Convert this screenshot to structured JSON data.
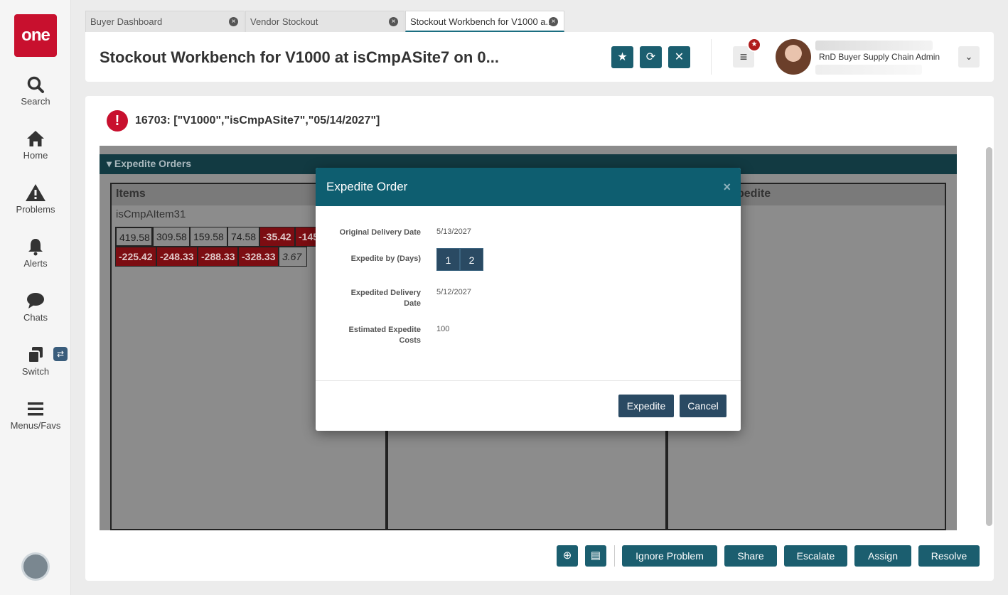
{
  "sidebar": {
    "logo": "one",
    "items": [
      {
        "label": "Search",
        "icon": "search-icon"
      },
      {
        "label": "Home",
        "icon": "home-icon"
      },
      {
        "label": "Problems",
        "icon": "warning-icon"
      },
      {
        "label": "Alerts",
        "icon": "bell-icon"
      },
      {
        "label": "Chats",
        "icon": "chat-icon"
      },
      {
        "label": "Switch",
        "icon": "switch-icon"
      },
      {
        "label": "Menus/Favs",
        "icon": "menu-icon"
      }
    ],
    "switch_badge": "⇄"
  },
  "tabs": [
    {
      "label": "Buyer Dashboard"
    },
    {
      "label": "Vendor Stockout"
    },
    {
      "label": "Stockout Workbench for V1000 a..."
    }
  ],
  "header": {
    "title": "Stockout Workbench for V1000 at isCmpASite7 on 0...",
    "user_role": "RnD Buyer Supply Chain Admin"
  },
  "main": {
    "error_text": "16703: [\"V1000\",\"isCmpASite7\",\"05/14/2027\"]",
    "panel_title": "Expedite Orders",
    "columns": [
      {
        "header": "Items"
      },
      {
        "header": ""
      },
      {
        "header": "pedite"
      }
    ],
    "item_name": "isCmpAItem31",
    "row1": [
      "419.58",
      "309.58",
      "159.58",
      "74.58",
      "-35.42",
      "-145"
    ],
    "row2": [
      "-225.42",
      "-248.33",
      "-288.33",
      "-328.33",
      "3.67"
    ]
  },
  "actions": {
    "ignore": "Ignore Problem",
    "share": "Share",
    "escalate": "Escalate",
    "assign": "Assign",
    "resolve": "Resolve"
  },
  "modal": {
    "title": "Expedite Order",
    "close": "×",
    "original_delivery_label": "Original Delivery Date",
    "original_delivery_value": "5/13/2027",
    "expedite_by_label": "Expedite by (Days)",
    "day_options": [
      "1",
      "2"
    ],
    "expedited_delivery_label_1": "Expedited Delivery",
    "expedited_delivery_label_2": "Date",
    "expedited_delivery_value": "5/12/2027",
    "estimated_cost_label_1": "Estimated Expedite",
    "estimated_cost_label_2": "Costs",
    "estimated_cost_value": "100",
    "expedite_button": "Expedite",
    "cancel_button": "Cancel"
  },
  "colors": {
    "accent": "#1b5e6f",
    "modal_header": "#0e5e70",
    "error": "#c8102e"
  }
}
